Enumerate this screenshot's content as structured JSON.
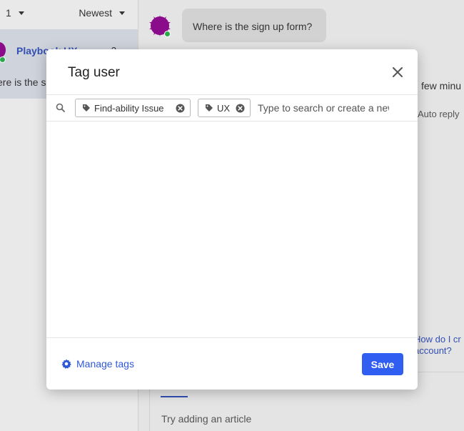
{
  "background": {
    "inbox": {
      "count_label": "1",
      "sort_label": "Newest",
      "conversation": {
        "name": "Playbook UX",
        "count": "2",
        "preview": "ere is the si"
      }
    },
    "chat": {
      "message": "Where is the sign up form?",
      "few_minutes_text": "few minu",
      "auto_reply_text": "Auto reply",
      "how_do_text": "How do I cr",
      "account_text": "account?",
      "article_hint": "Try adding an article"
    }
  },
  "modal": {
    "title": "Tag user",
    "tags": [
      {
        "label": "Find-ability Issue"
      },
      {
        "label": "UX"
      }
    ],
    "search_placeholder": "Type to search or create a new tag",
    "manage_tags_label": "Manage tags",
    "save_label": "Save"
  },
  "colors": {
    "accent": "#2f5ef0",
    "link": "#2f58d6",
    "avatar": "#8a0c8a",
    "online": "#2aa84a"
  },
  "icons": {
    "search": "search-icon",
    "tag": "tag-icon",
    "remove": "remove-circle-icon",
    "close": "close-icon",
    "gear": "gear-icon"
  }
}
